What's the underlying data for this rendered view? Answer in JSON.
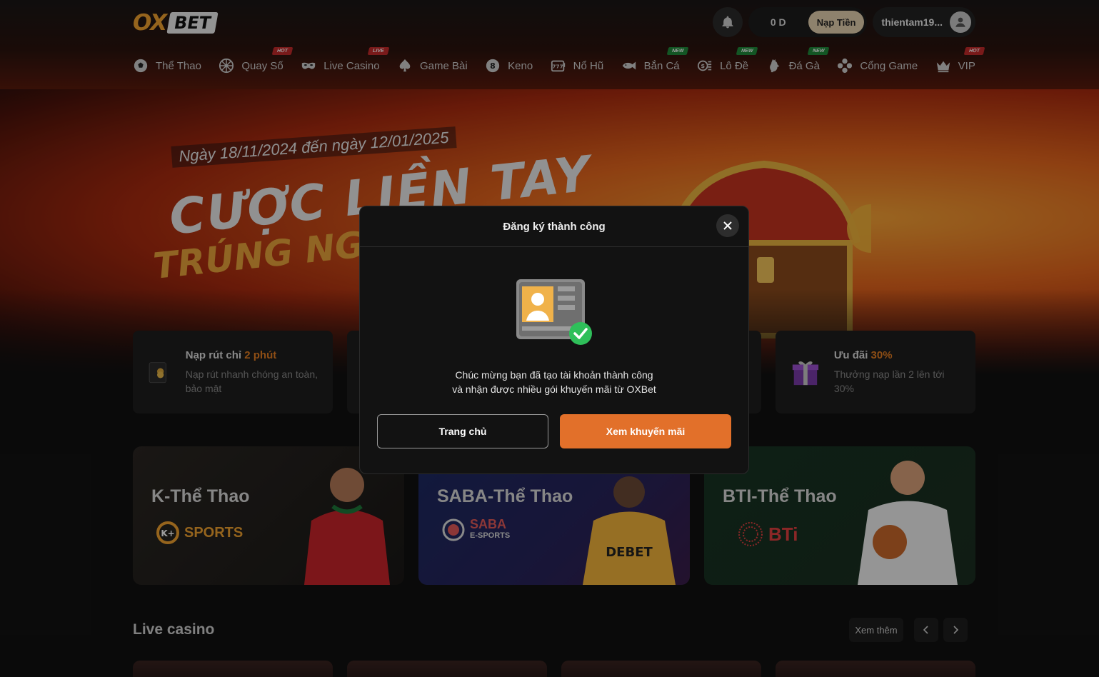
{
  "header": {
    "logo_ox": "OX",
    "logo_bet": "BET",
    "balance": "0 D",
    "deposit_label": "Nạp Tiền",
    "username": "thientam19..."
  },
  "nav": [
    {
      "label": "Thể Thao",
      "icon": "soccer-ball-icon",
      "badge": ""
    },
    {
      "label": "Quay Số",
      "icon": "lottery-ball-icon",
      "badge": "HOT"
    },
    {
      "label": "Live Casino",
      "icon": "mask-icon",
      "badge": "LIVE"
    },
    {
      "label": "Game Bài",
      "icon": "spade-icon",
      "badge": ""
    },
    {
      "label": "Keno",
      "icon": "keno-ball-icon",
      "badge": ""
    },
    {
      "label": "Nổ Hũ",
      "icon": "slot-machine-icon",
      "badge": ""
    },
    {
      "label": "Bắn Cá",
      "icon": "fish-icon",
      "badge": "NEW"
    },
    {
      "label": "Lô Đề",
      "icon": "lottery-icon",
      "badge": "NEW"
    },
    {
      "label": "Đá Gà",
      "icon": "rooster-icon",
      "badge": "NEW"
    },
    {
      "label": "Cổng Game",
      "icon": "gamepad-icon",
      "badge": ""
    },
    {
      "label": "VIP",
      "icon": "crown-icon",
      "badge": "HOT"
    }
  ],
  "banner": {
    "date": "Ngày 18/11/2024 đến ngày 12/01/2025",
    "title_line1": "CƯỢC LIỀN TAY",
    "title_line2": "TRÚNG NGAY"
  },
  "features": [
    {
      "title": "Nạp rút chỉ ",
      "highlight": "2 phút",
      "desc": "Nạp rút nhanh chóng an toàn, bảo mật",
      "icon": "wallet-coins-icon"
    },
    {
      "title": "",
      "highlight": "",
      "desc": "",
      "icon": ""
    },
    {
      "title": "",
      "highlight": "",
      "desc": "",
      "icon": ""
    },
    {
      "title": "Ưu đãi ",
      "highlight": "30%",
      "desc": "Thưởng nạp lần 2 lên tới 30%",
      "icon": "gift-box-icon"
    }
  ],
  "sports": [
    {
      "title": "K-Thể Thao",
      "brand": "SPORTS",
      "brand_color": "#f0a230"
    },
    {
      "title": "SABA-Thể Thao",
      "brand": "SABA",
      "brand_sub": "E-SPORTS",
      "brand_color": "#e35a5a"
    },
    {
      "title": "BTI-Thể Thao",
      "brand": "BTi",
      "brand_color": "#e04040"
    }
  ],
  "live_casino": {
    "title": "Live casino",
    "more_label": "Xem thêm"
  },
  "modal": {
    "title": "Đăng ký thành công",
    "message_line1": "Chúc mừng bạn đã tạo tài khoản thành công",
    "message_line2": "và nhận được nhiều gói khuyến mãi từ OXBet",
    "home_label": "Trang chủ",
    "promo_label": "Xem khuyến mãi"
  },
  "colors": {
    "accent": "#e2702a",
    "brand_gold": "#f0a230",
    "badge_hot": "#c42a2a",
    "badge_new": "#1f8a3a"
  }
}
